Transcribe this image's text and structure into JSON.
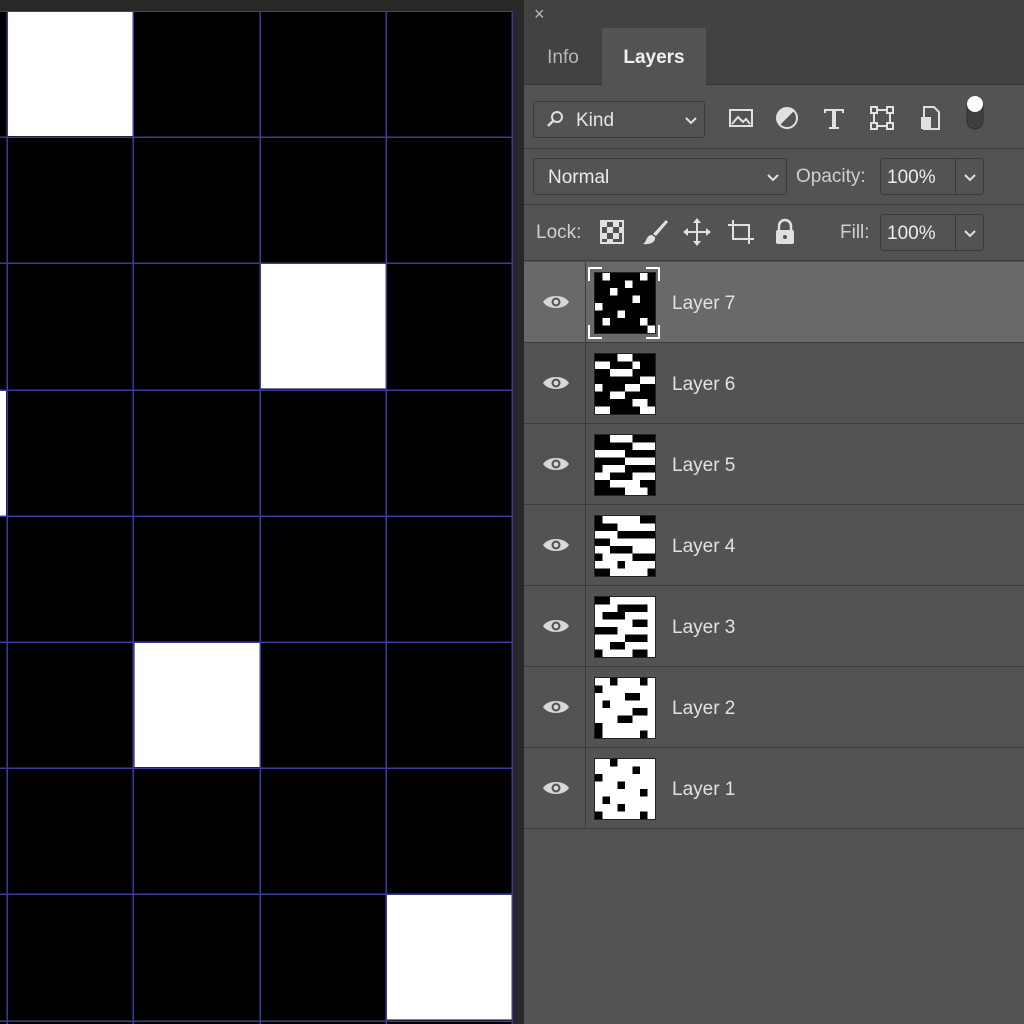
{
  "canvas": {
    "background": "#000000",
    "cell_color": "#ffffff",
    "grid_color": "#3b3b9e",
    "white_cells": [
      [
        0,
        0
      ],
      [
        2,
        2
      ],
      [
        5,
        1
      ],
      [
        7,
        3
      ]
    ]
  },
  "panel": {
    "close_glyph": "×",
    "tabs": [
      {
        "label": "Info",
        "active": false
      },
      {
        "label": "Layers",
        "active": true
      }
    ],
    "filter": {
      "kind_label": "Kind",
      "icons": [
        "image-filter-icon",
        "adjustment-filter-icon",
        "type-filter-icon",
        "shape-filter-icon",
        "smart-object-filter-icon"
      ]
    },
    "blend_mode": "Normal",
    "opacity_label": "Opacity:",
    "opacity_value": "100%",
    "lock_label": "Lock:",
    "fill_label": "Fill:",
    "fill_value": "100%"
  },
  "layers": [
    {
      "name": "Layer 7",
      "selected": true
    },
    {
      "name": "Layer 6",
      "selected": false
    },
    {
      "name": "Layer 5",
      "selected": false
    },
    {
      "name": "Layer 4",
      "selected": false
    },
    {
      "name": "Layer 3",
      "selected": false
    },
    {
      "name": "Layer 2",
      "selected": false
    },
    {
      "name": "Layer 1",
      "selected": false
    }
  ]
}
